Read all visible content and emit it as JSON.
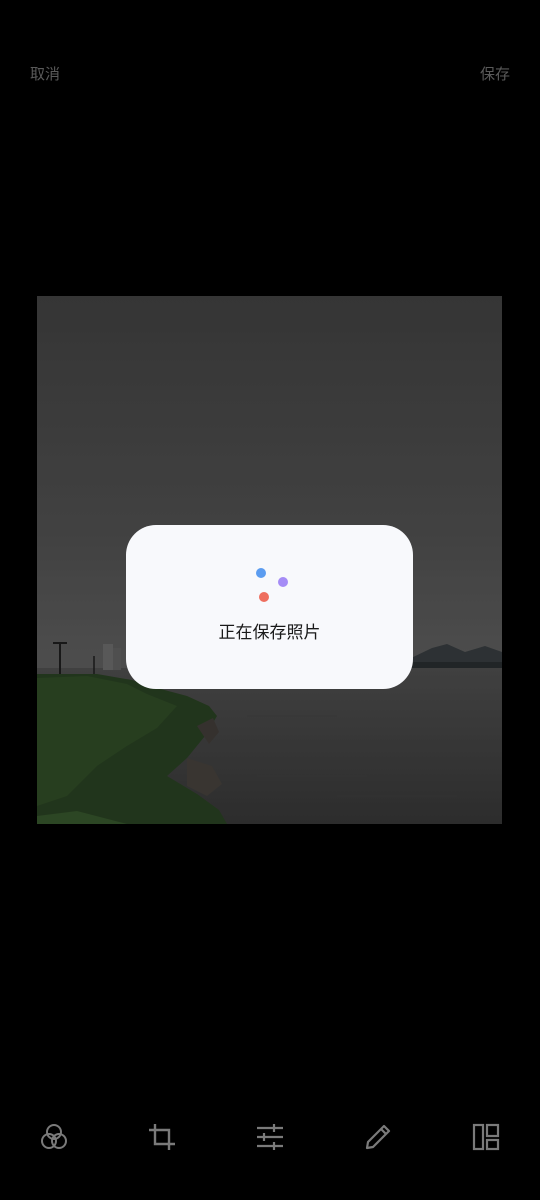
{
  "header": {
    "cancel_label": "取消",
    "save_label": "保存"
  },
  "dialog": {
    "message": "正在保存照片",
    "spinner_colors": [
      "#5b9cf0",
      "#a58cf6",
      "#ee6e5e"
    ]
  },
  "toolbar": {
    "tools": [
      {
        "icon": "filter-icon"
      },
      {
        "icon": "crop-icon"
      },
      {
        "icon": "adjust-icon"
      },
      {
        "icon": "pencil-icon"
      },
      {
        "icon": "layout-icon"
      }
    ],
    "icon_color": "#7a7a7a"
  }
}
